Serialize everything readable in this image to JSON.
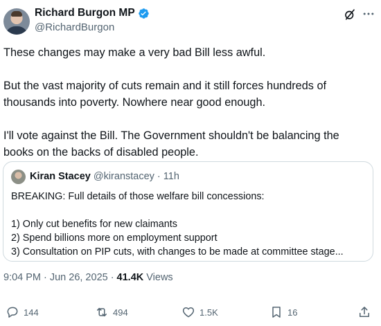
{
  "author": {
    "name": "Richard Burgon MP",
    "handle": "@RichardBurgon"
  },
  "tweet": {
    "paragraphs": [
      "These changes may make a very bad Bill less awful.",
      "But the vast majority of cuts remain and it still forces hundreds of",
      "thousands into poverty. Nowhere near good enough.",
      "I'll vote against the Bill. The Government shouldn't be balancing the",
      "books on the backs of disabled people."
    ]
  },
  "quote": {
    "name": "Kiran Stacey",
    "handle": "@kiranstacey",
    "separator": "·",
    "time": "11h",
    "lines": [
      "BREAKING: Full details of those welfare bill concessions:",
      "1) Only cut benefits for new claimants",
      "2) Spend billions more on employment support",
      "3) Consultation on PIP cuts, with changes to be made at committee stage..."
    ]
  },
  "meta": {
    "time": "9:04 PM",
    "sep1": "·",
    "date": "Jun 26, 2025",
    "sep2": "·",
    "views_count": "41.4K",
    "views_label": "Views"
  },
  "actions": {
    "replies": "144",
    "reposts": "494",
    "likes": "1.5K",
    "bookmarks": "16"
  },
  "colors": {
    "verified": "#1d9bf0",
    "text": "#0f1419",
    "secondary": "#536471",
    "border": "#cfd9de"
  },
  "icons": [
    "verified-badge-icon",
    "grok-icon",
    "more-icon",
    "reply-icon",
    "repost-icon",
    "like-icon",
    "bookmark-icon",
    "share-icon"
  ]
}
